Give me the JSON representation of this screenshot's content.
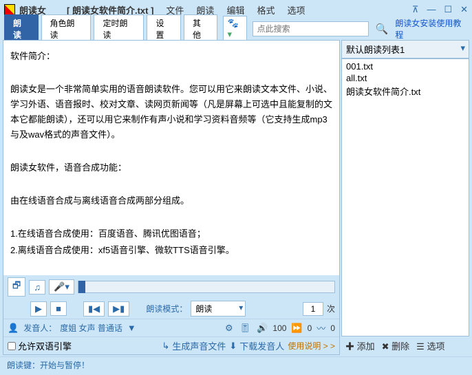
{
  "title": {
    "app": "朗读女",
    "doc": "[ 朗读女软件简介.txt ]"
  },
  "menu": [
    "文件",
    "朗读",
    "编辑",
    "格式",
    "选项"
  ],
  "tabs": [
    "朗读",
    "角色朗读",
    "定时朗读",
    "设置",
    "其他"
  ],
  "search": {
    "placeholder": "点此搜索"
  },
  "help_link": "朗读女安装使用教程",
  "content": {
    "p1": "软件简介：",
    "p2": "朗读女是一个非常简单实用的语音朗读软件。您可以用它来朗读文本文件、小说、学习外语、语音报时、校对文章、读网页新闻等（凡是屏幕上可选中且能复制的文本它都能朗读），还可以用它来制作有声小说和学习资料音频等（它支持生成mp3与及wav格式的声音文件）。",
    "p3": "朗读女软件，语音合成功能：",
    "p4": "由在线语音合成与离线语音合成两部分组成。",
    "p5": "1.在线语音合成使用：百度语音、腾讯优图语音；",
    "p6": "2.离线语音合成使用：xf5语音引擎、微软TTS语音引擎。"
  },
  "playback": {
    "mode_label": "朗读模式：",
    "mode_value": "朗读",
    "count": "1",
    "count_unit": "次"
  },
  "speaker": {
    "label": "发音人：",
    "value": "度姐  女声  普通话",
    "volume": "100",
    "speed": "0",
    "pitch": "0"
  },
  "bottom": {
    "dual_engine": "允许双语引擎",
    "gen_audio": "生成声音文件",
    "download": "下载发音人",
    "usage": "使用说明  > >"
  },
  "right": {
    "list_name": "默认朗读列表1",
    "files": [
      "001.txt",
      "all.txt",
      "朗读女软件简介.txt"
    ],
    "add": "添加",
    "del": "删除",
    "opts": "选项"
  },
  "status": "朗读键：开始与暂停！"
}
